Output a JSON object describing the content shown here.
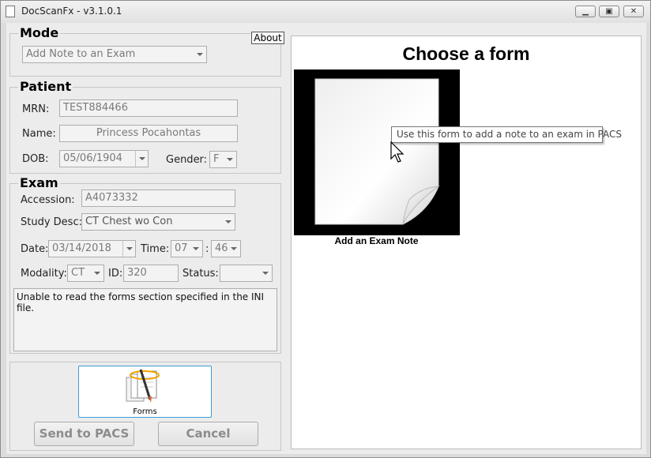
{
  "window": {
    "title": "DocScanFx  -  v3.1.0.1"
  },
  "about_label": "About",
  "mode": {
    "title": "Mode",
    "selected": "Add Note to an Exam"
  },
  "patient": {
    "title": "Patient",
    "mrn_label": "MRN:",
    "mrn": "TEST884466",
    "name_label": "Name:",
    "name": "Princess Pocahontas",
    "dob_label": "DOB:",
    "dob": "05/06/1904",
    "gender_label": "Gender:",
    "gender": "F"
  },
  "exam": {
    "title": "Exam",
    "accession_label": "Accession:",
    "accession": "A4073332",
    "study_label": "Study Desc:",
    "study": "CT Chest wo Con",
    "date_label": "Date:",
    "date": "03/14/2018",
    "time_label": "Time:",
    "hour": "07",
    "time_sep": ":",
    "minute": "46",
    "modality_label": "Modality:",
    "modality": "CT",
    "id_label": "ID:",
    "id": "320",
    "status_label": "Status:",
    "status": ""
  },
  "message": "Unable to read the forms section specified in the INI file.",
  "forms_button": "Forms",
  "send_button": "Send to PACS",
  "cancel_button": "Cancel",
  "panel": {
    "title": "Choose a form",
    "form_caption": "Add an Exam Note",
    "tooltip": "Use this form to add a note to an exam in PACS"
  }
}
